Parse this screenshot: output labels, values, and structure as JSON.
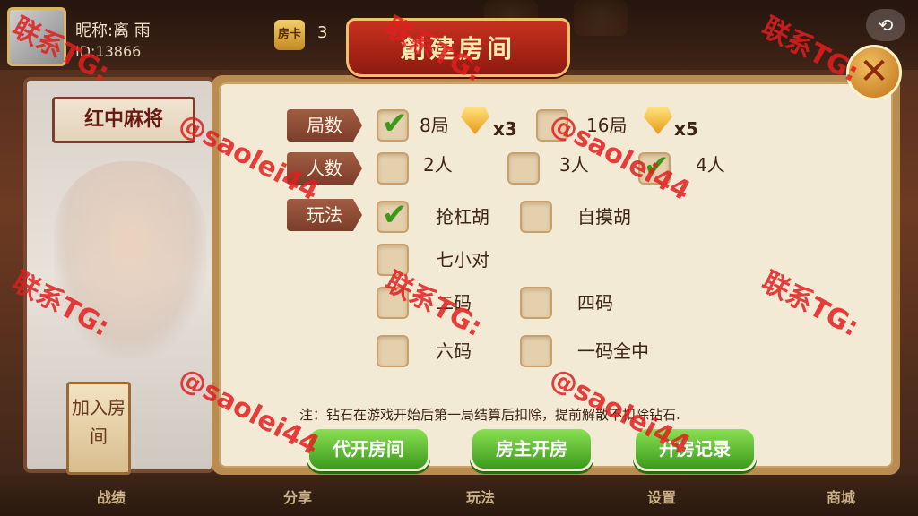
{
  "header": {
    "nickname": "昵称:离 雨",
    "user_id": "ID:13866",
    "card_badge": "房卡",
    "card_count": "3",
    "back_icon": "back-icon"
  },
  "left_panel": {
    "game_tab": "红中麻将",
    "join_room": "加入房间"
  },
  "dialog": {
    "title": "創建房间",
    "close_icon": "close-x-icon",
    "rows": {
      "rounds": {
        "label": "局数",
        "options": [
          {
            "text": "8局",
            "checked": true,
            "gem": "x3"
          },
          {
            "text": "16局",
            "checked": false,
            "gem": "x5"
          }
        ]
      },
      "players": {
        "label": "人数",
        "options": [
          {
            "text": "2人",
            "checked": false
          },
          {
            "text": "3人",
            "checked": false
          },
          {
            "text": "4人",
            "checked": true
          }
        ]
      },
      "rules": {
        "label": "玩法",
        "options": [
          {
            "text": "抢杠胡",
            "checked": true
          },
          {
            "text": "自摸胡",
            "checked": false
          },
          {
            "text": "七小对",
            "checked": false
          },
          {
            "text": "二码",
            "checked": false
          },
          {
            "text": "四码",
            "checked": false
          },
          {
            "text": "六码",
            "checked": false
          },
          {
            "text": "一码全中",
            "checked": false
          }
        ]
      }
    },
    "note": "注：钻石在游戏开始后第一局结算后扣除，提前解散不扣除钻石.",
    "buttons": {
      "proxy_open": "代开房间",
      "host_open": "房主开房",
      "open_record": "开房记录"
    }
  },
  "bottom_menu": [
    "战绩",
    "分享",
    "玩法",
    "设置",
    "商城"
  ],
  "watermark": {
    "line1": "联系TG:",
    "line2": "@saolei44"
  },
  "colors": {
    "banner_red": "#c8321e",
    "button_green": "#3c9a1c",
    "panel_cream": "#f3ead6",
    "watermark_red": "#e11e1e"
  }
}
